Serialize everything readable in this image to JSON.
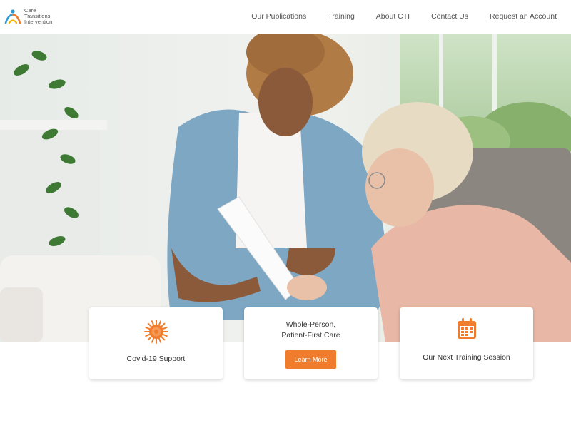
{
  "brand": {
    "name_lines": [
      "Care",
      "Transitions",
      "Intervention"
    ],
    "accent": "#ef7d2d",
    "secondary": "#2b9ad6"
  },
  "nav": {
    "items": [
      {
        "label": "Our Publications"
      },
      {
        "label": "Training"
      },
      {
        "label": "About CTI"
      },
      {
        "label": "Contact Us"
      },
      {
        "label": "Request an Account"
      }
    ]
  },
  "cards": {
    "covid": {
      "label": "Covid-19 Support",
      "icon": "virus-icon"
    },
    "care": {
      "title_lines": [
        "Whole-Person,",
        "Patient-First Care"
      ],
      "button": "Learn More"
    },
    "training": {
      "label": "Our Next Training Session",
      "icon": "calendar-icon"
    }
  }
}
